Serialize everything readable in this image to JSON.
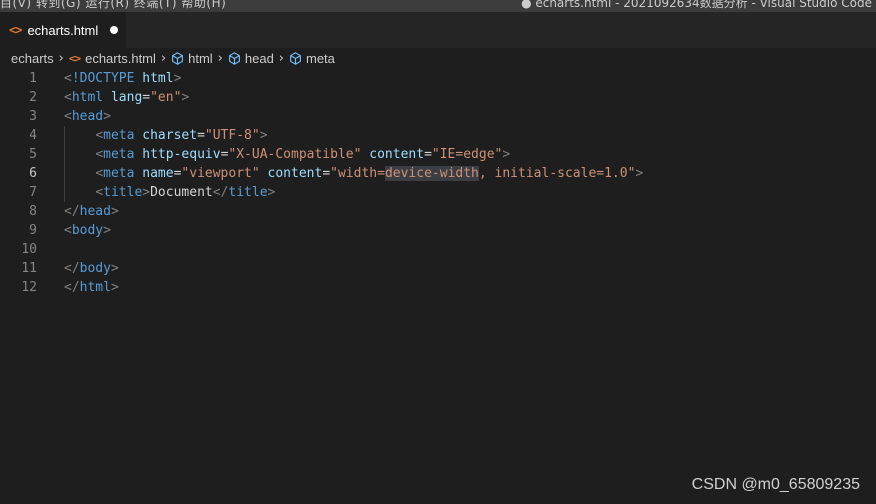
{
  "titlebar": {
    "menus": "目(V)   转到(G)   运行(R)   终端(T)   帮助(H)",
    "window_title": "● echarts.html - 2021092634数据分析 - Visual Studio Code"
  },
  "tab": {
    "icon": "html-file-icon",
    "label": "echarts.html",
    "dirty": true
  },
  "breadcrumb": {
    "items": [
      "echarts",
      "echarts.html",
      "html",
      "head",
      "meta"
    ],
    "separator": "›"
  },
  "editor": {
    "active_line": 6,
    "lines": [
      {
        "num": "1",
        "tokens": [
          [
            "punc",
            "<"
          ],
          [
            "tag",
            "!DOCTYPE"
          ],
          [
            "text",
            " "
          ],
          [
            "attr",
            "html"
          ],
          [
            "punc",
            ">"
          ]
        ]
      },
      {
        "num": "2",
        "tokens": [
          [
            "punc",
            "<"
          ],
          [
            "tag",
            "html"
          ],
          [
            "text",
            " "
          ],
          [
            "attr",
            "lang"
          ],
          [
            "text",
            "="
          ],
          [
            "str",
            "\"en\""
          ],
          [
            "punc",
            ">"
          ]
        ]
      },
      {
        "num": "3",
        "tokens": [
          [
            "punc",
            "<"
          ],
          [
            "tag",
            "head"
          ],
          [
            "punc",
            ">"
          ]
        ]
      },
      {
        "num": "4",
        "tokens": [
          [
            "text",
            "    "
          ],
          [
            "punc",
            "<"
          ],
          [
            "tag",
            "meta"
          ],
          [
            "text",
            " "
          ],
          [
            "attr",
            "charset"
          ],
          [
            "text",
            "="
          ],
          [
            "str",
            "\"UTF-8\""
          ],
          [
            "punc",
            ">"
          ]
        ]
      },
      {
        "num": "5",
        "tokens": [
          [
            "text",
            "    "
          ],
          [
            "punc",
            "<"
          ],
          [
            "tag",
            "meta"
          ],
          [
            "text",
            " "
          ],
          [
            "attr",
            "http-equiv"
          ],
          [
            "text",
            "="
          ],
          [
            "str",
            "\"X-UA-Compatible\""
          ],
          [
            "text",
            " "
          ],
          [
            "attr",
            "content"
          ],
          [
            "text",
            "="
          ],
          [
            "str",
            "\"IE=edge\""
          ],
          [
            "punc",
            ">"
          ]
        ]
      },
      {
        "num": "6",
        "tokens": [
          [
            "text",
            "    "
          ],
          [
            "punc",
            "<"
          ],
          [
            "tag",
            "meta"
          ],
          [
            "text",
            " "
          ],
          [
            "attr",
            "name"
          ],
          [
            "text",
            "="
          ],
          [
            "str",
            "\"viewport\""
          ],
          [
            "text",
            " "
          ],
          [
            "attr",
            "content"
          ],
          [
            "text",
            "="
          ],
          [
            "str",
            "\"width="
          ],
          [
            "strhl",
            "device-width"
          ],
          [
            "str",
            ", initial-scale=1.0\""
          ],
          [
            "punc",
            ">"
          ]
        ]
      },
      {
        "num": "7",
        "tokens": [
          [
            "text",
            "    "
          ],
          [
            "punc",
            "<"
          ],
          [
            "tag",
            "title"
          ],
          [
            "punc",
            ">"
          ],
          [
            "text",
            "Document"
          ],
          [
            "punc",
            "</"
          ],
          [
            "tag",
            "title"
          ],
          [
            "punc",
            ">"
          ]
        ]
      },
      {
        "num": "8",
        "tokens": [
          [
            "punc",
            "</"
          ],
          [
            "tag",
            "head"
          ],
          [
            "punc",
            ">"
          ]
        ]
      },
      {
        "num": "9",
        "tokens": [
          [
            "punc",
            "<"
          ],
          [
            "tag",
            "body"
          ],
          [
            "punc",
            ">"
          ]
        ]
      },
      {
        "num": "10",
        "tokens": []
      },
      {
        "num": "11",
        "tokens": [
          [
            "punc",
            "</"
          ],
          [
            "tag",
            "body"
          ],
          [
            "punc",
            ">"
          ]
        ]
      },
      {
        "num": "12",
        "tokens": [
          [
            "punc",
            "</"
          ],
          [
            "tag",
            "html"
          ],
          [
            "punc",
            ">"
          ]
        ]
      }
    ]
  },
  "watermark": "CSDN @m0_65809235",
  "colors": {
    "editor_bg": "#1e1e1e",
    "tab_bar_bg": "#252526",
    "tag": "#569cd6",
    "attribute": "#9cdcfe",
    "string": "#ce9178",
    "punctuation": "#808080",
    "html_icon": "#e37933"
  }
}
